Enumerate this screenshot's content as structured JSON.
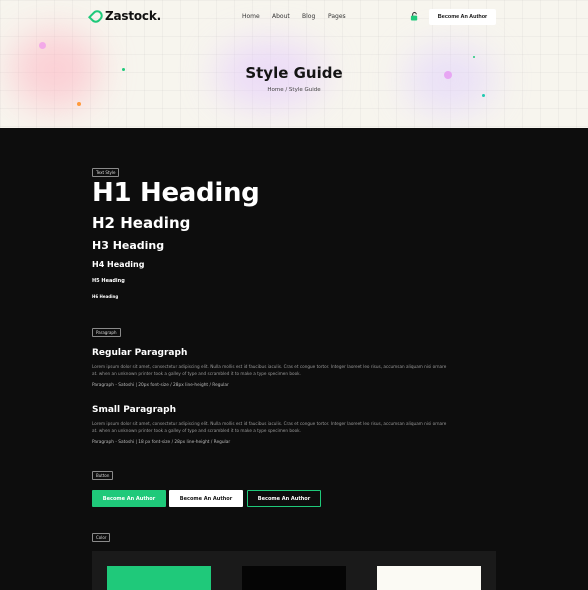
{
  "nav": {
    "logo": "Zastock.",
    "menu": [
      "Home",
      "About",
      "Blog",
      "Pages"
    ],
    "cta_label": "Become An Author"
  },
  "hero": {
    "title": "Style Guide",
    "breadcrumb": "Home / Style Guide"
  },
  "text_style": {
    "tag": "Text Style",
    "h1": "H1 Heading",
    "h2": "H2 Heading",
    "h3": "H3 Heading",
    "h4": "H4 Heading",
    "h5": "H5 Heading",
    "h6": "H6 Heading"
  },
  "paragraph": {
    "tag": "Paragraph",
    "regular_title": "Regular Paragraph",
    "regular_text": "Lorem ipsum dolor sit amet, consectetur adipiscing elit. Nulla mollis est id faucibus iaculis. Cras et congue tortor. Integer laoreet leo risus, accumsan aliquam nisi ornare at. when an unknown printer took a galley of type and scrambled it to make a type specimen book.",
    "regular_meta": "Paragraph - Satoshi | 20px font-size / 28px line-height / Regular",
    "small_title": "Small Paragraph",
    "small_text": "Lorem ipsum dolor sit amet, consectetur adipiscing elit. Nulla mollis est id faucibus iaculis. Cras et congue tortor. Integer laoreet leo risus, accumsan aliquam nisi ornare at. when an unknown printer took a galley of type and scrambled it to make a type specimen book.",
    "small_meta": "Paragraph - Satoshi | 18 px font-size / 28px line-height / Regular"
  },
  "buttons": {
    "tag": "Button",
    "primary": "Become An Author",
    "secondary": "Become An Author",
    "outline": "Become An Author"
  },
  "colors": {
    "tag": "Color",
    "accent": "#1fc97a",
    "dark": "#050505",
    "light": "#fbfaf4"
  }
}
